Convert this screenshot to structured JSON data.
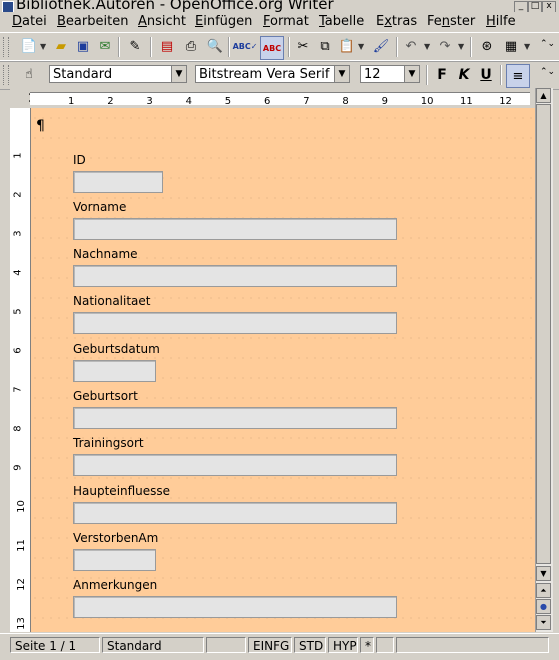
{
  "window": {
    "title": "Bibliothek.Autoren - OpenOffice.org Writer",
    "controls": [
      "_",
      "□",
      "x"
    ]
  },
  "menu": [
    "Datei",
    "Bearbeiten",
    "Ansicht",
    "Einfügen",
    "Format",
    "Tabelle",
    "Extras",
    "Fenster",
    "Hilfe"
  ],
  "menu_mnemonic": [
    "D",
    "B",
    "A",
    "E",
    "F",
    "T",
    "x",
    "n",
    "H"
  ],
  "toolbar1_icons": [
    "new-icon",
    "open-icon",
    "save-icon",
    "email-icon",
    "edit-file-icon",
    "pdf-icon",
    "print-icon",
    "page-preview-icon",
    "spellcheck-icon",
    "autospellcheck-icon",
    "cut-icon",
    "copy-icon",
    "paste-icon",
    "format-paintbrush-icon",
    "undo-icon",
    "redo-icon",
    "navigator-icon",
    "table-icon"
  ],
  "format_toolbar": {
    "style": "Standard",
    "font": "Bitstream Vera Serif",
    "size": "12",
    "bold": "F",
    "italic": "K",
    "underline": "U"
  },
  "ruler": {
    "h_numbers": [
      "1",
      "2",
      "3",
      "4",
      "5",
      "6",
      "7",
      "8",
      "9",
      "10",
      "11",
      "12"
    ],
    "v_numbers": [
      "1",
      "2",
      "3",
      "4",
      "5",
      "6",
      "7",
      "8",
      "9",
      "10",
      "11",
      "12",
      "13"
    ]
  },
  "document": {
    "paragraph_mark": "¶",
    "fields": [
      {
        "label": "ID",
        "value": ""
      },
      {
        "label": "Vorname",
        "value": ""
      },
      {
        "label": "Nachname",
        "value": ""
      },
      {
        "label": "Nationalitaet",
        "value": ""
      },
      {
        "label": "Geburtsdatum",
        "value": ""
      },
      {
        "label": "Geburtsort",
        "value": ""
      },
      {
        "label": "Trainingsort",
        "value": ""
      },
      {
        "label": "Haupteinfluesse",
        "value": ""
      },
      {
        "label": "VerstorbenAm",
        "value": ""
      },
      {
        "label": "Anmerkungen",
        "value": ""
      }
    ]
  },
  "statusbar": {
    "page": "Seite 1 / 1",
    "style": "Standard",
    "zoom": "",
    "insert_mode": "EINFG",
    "selection_mode": "STD",
    "hyperlink_mode": "HYP",
    "modified": "*"
  },
  "colors": {
    "document_background": "#ffcc99",
    "field_fill": "#e4e4e4",
    "chrome": "#d4d0c8"
  }
}
